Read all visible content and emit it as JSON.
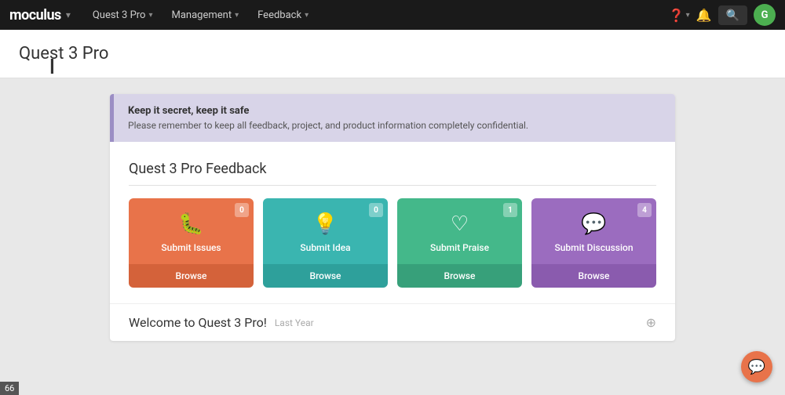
{
  "navbar": {
    "logo": "moculus",
    "items": [
      {
        "label": "Quest 3 Pro",
        "hasChevron": true
      },
      {
        "label": "Management",
        "hasChevron": true
      },
      {
        "label": "Feedback",
        "hasChevron": true
      }
    ],
    "avatar_initial": "G"
  },
  "page": {
    "title": "Quest 3 Pro"
  },
  "banner": {
    "title": "Keep it secret, keep it safe",
    "text": "Please remember to keep all feedback, project, and product information completely confidential."
  },
  "feedback_section": {
    "heading": "Quest 3 Pro Feedback",
    "cards": [
      {
        "id": "issues",
        "icon": "🐛",
        "label": "Submit Issues",
        "browse": "Browse",
        "badge": "0",
        "color_class": "card-issues"
      },
      {
        "id": "idea",
        "icon": "💡",
        "label": "Submit Idea",
        "browse": "Browse",
        "badge": "0",
        "color_class": "card-idea"
      },
      {
        "id": "praise",
        "icon": "♡",
        "label": "Submit Praise",
        "browse": "Browse",
        "badge": "1",
        "color_class": "card-praise"
      },
      {
        "id": "discussion",
        "icon": "💬",
        "label": "Submit Discussion",
        "browse": "Browse",
        "badge": "4",
        "color_class": "card-discussion"
      }
    ]
  },
  "welcome": {
    "title": "Welcome to Quest 3 Pro!",
    "date": "Last Year"
  },
  "status_bar": {
    "number": "66"
  }
}
